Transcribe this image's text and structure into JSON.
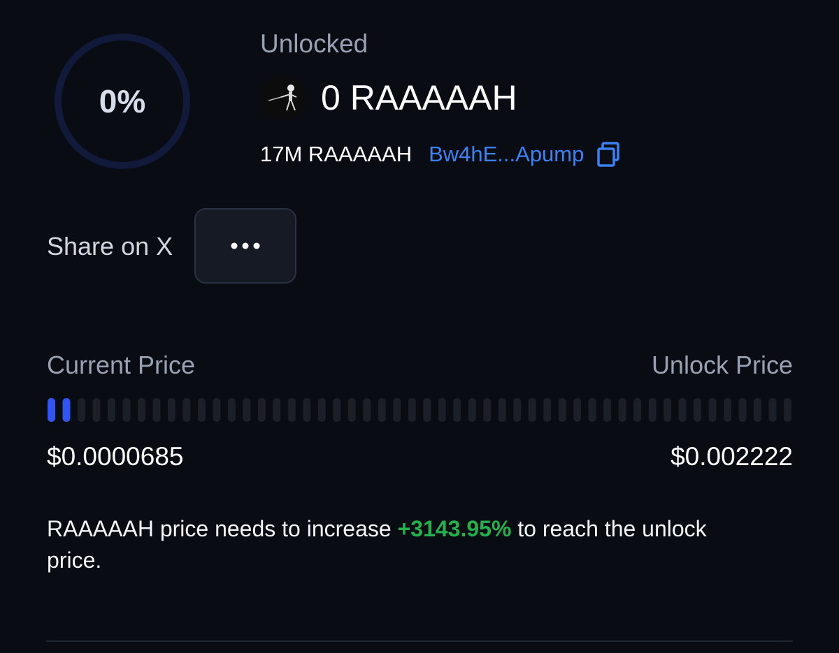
{
  "unlock": {
    "percent_label": "0%",
    "progress_fraction": 0.0,
    "status_label": "Unlocked",
    "amount_text": "0 RAAAAAH",
    "token_icon": "skeleton-token-avatar"
  },
  "token": {
    "supply_text": "17M RAAAAAH",
    "address_short": "Bw4hE...Apump",
    "copy_icon": "copy-icon"
  },
  "actions": {
    "share_label": "Share on X",
    "more_icon": "more-dots-icon"
  },
  "price": {
    "current_label": "Current Price",
    "unlock_label": "Unlock Price",
    "current_value": "$0.0000685",
    "unlock_value": "$0.002222",
    "progress_segments_total": 50,
    "progress_segments_filled": 2,
    "active_color": "#2f55f5",
    "inactive_color": "#1b1f28"
  },
  "note": {
    "prefix": "RAAAAAH price needs to increase ",
    "percent": "+3143.95%",
    "suffix": " to reach the unlock price."
  },
  "colors": {
    "accent_blue": "#3b82f6",
    "positive_green": "#22b14c",
    "ring_track": "#111a3a"
  }
}
